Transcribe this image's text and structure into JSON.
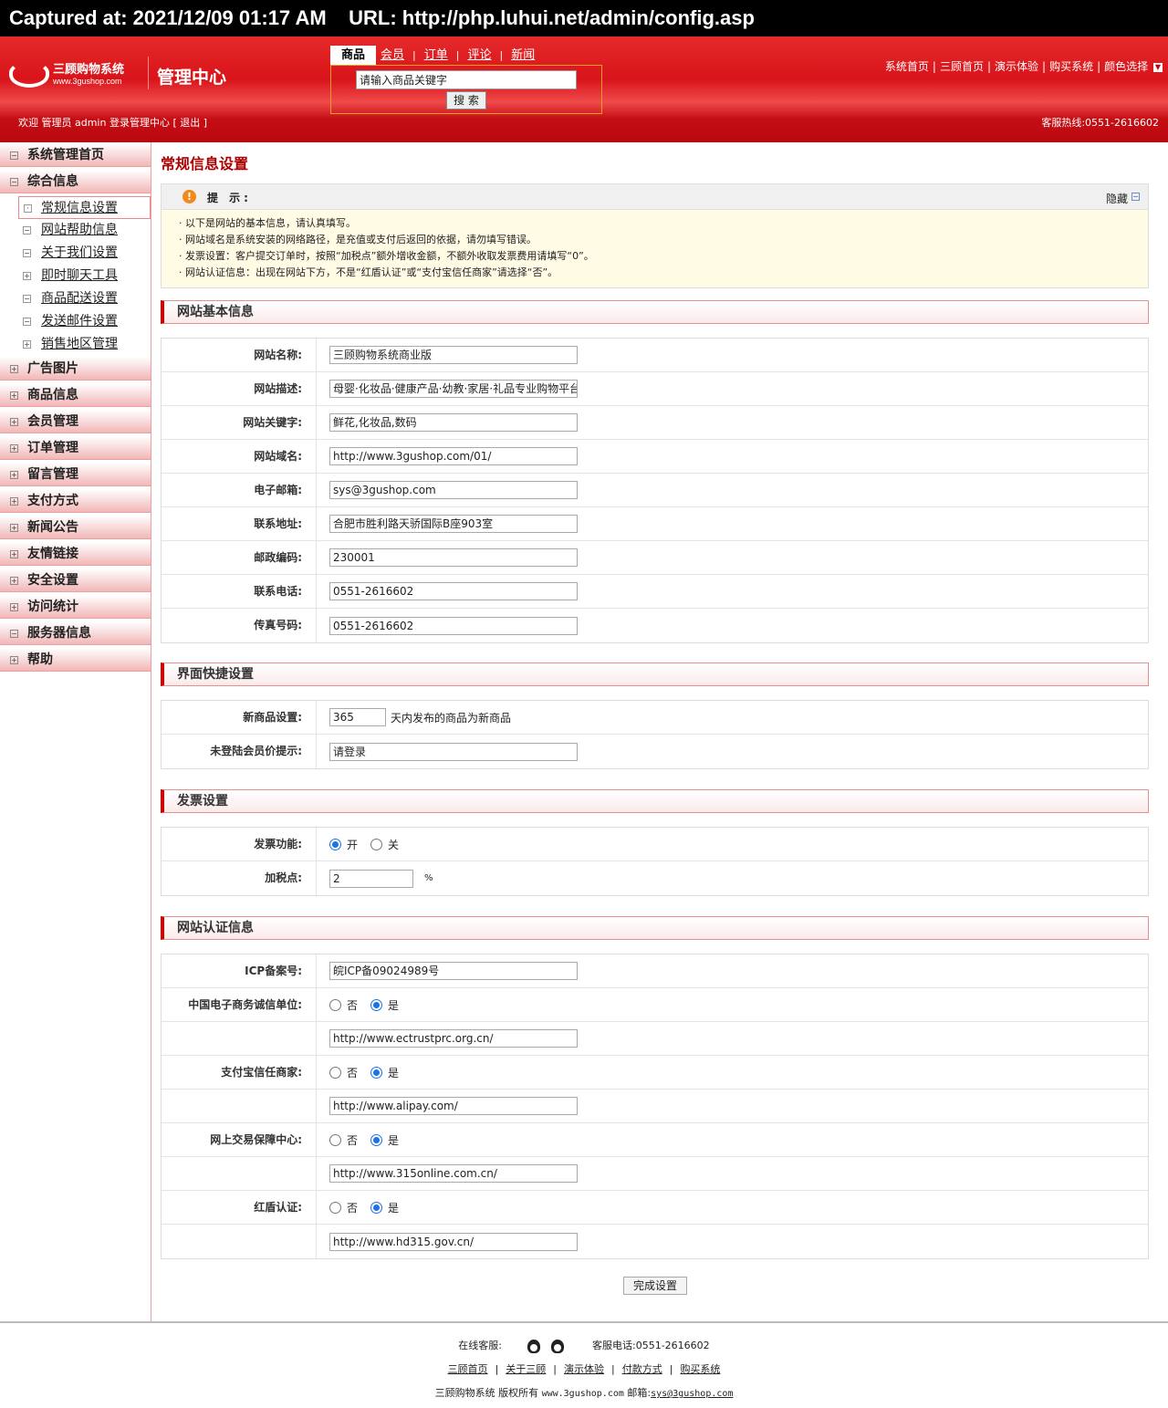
{
  "capture": {
    "text": "Captured at: 2021/12/09 01:17 AM    URL: http://php.luhui.net/admin/config.asp"
  },
  "header": {
    "logo_name": "三顾购物系统",
    "logo_url": "www.3gushop.com",
    "admin_title": "管理中心",
    "search_tabs": [
      "商品",
      "会员",
      "订单",
      "评论",
      "新闻"
    ],
    "search_placeholder": "请输入商品关键字",
    "search_button": "搜 索",
    "top_links": [
      "系统首页",
      "三顾首页",
      "演示体验",
      "购买系统",
      "颜色选择"
    ],
    "welcome": "欢迎 管理员 admin 登录管理中心 [ 退出 ]",
    "hotline": "客服热线:0551-2616602"
  },
  "sidebar": {
    "top": [
      {
        "icon": "minus",
        "label": "系统管理首页"
      },
      {
        "icon": "minus",
        "label": "综合信息"
      }
    ],
    "sub": [
      {
        "label": "常规信息设置",
        "active": true
      },
      {
        "label": "网站帮助信息"
      },
      {
        "label": "关于我们设置"
      },
      {
        "label": "即时聊天工具"
      },
      {
        "label": "商品配送设置"
      },
      {
        "label": "发送邮件设置"
      },
      {
        "label": "销售地区管理"
      }
    ],
    "rest": [
      "广告图片",
      "商品信息",
      "会员管理",
      "订单管理",
      "留言管理",
      "支付方式",
      "新闻公告",
      "友情链接",
      "安全设置",
      "访问统计",
      "服务器信息",
      "帮助"
    ]
  },
  "page": {
    "title": "常规信息设置",
    "tip_label": "提 示:",
    "tip_hide": "隐藏",
    "tips": [
      "· 以下是网站的基本信息，请认真填写。",
      "· 网站域名是系统安装的网络路径，是充值或支付后返回的依据，请勿填写错误。",
      "· 发票设置：客户提交订单时，按照“加税点”额外增收金额，不额外收取发票费用请填写“0”。",
      "· 网站认证信息：出现在网站下方，不是“红盾认证”或“支付宝信任商家”请选择“否”。"
    ],
    "sections": {
      "basic": "网站基本信息",
      "ui": "界面快捷设置",
      "invoice": "发票设置",
      "cert": "网站认证信息"
    },
    "basic_fields": [
      {
        "label": "网站名称:",
        "value": "三顾购物系统商业版"
      },
      {
        "label": "网站描述:",
        "value": "母婴·化妆品·健康产品·幼教·家居·礼品专业购物平台"
      },
      {
        "label": "网站关键字:",
        "value": "鲜花,化妆品,数码"
      },
      {
        "label": "网站域名:",
        "value": "http://www.3gushop.com/01/"
      },
      {
        "label": "电子邮箱:",
        "value": "sys@3gushop.com"
      },
      {
        "label": "联系地址:",
        "value": "合肥市胜利路天骄国际B座903室"
      },
      {
        "label": "邮政编码:",
        "value": "230001"
      },
      {
        "label": "联系电话:",
        "value": "0551-2616602"
      },
      {
        "label": "传真号码:",
        "value": "0551-2616602"
      }
    ],
    "ui_fields": {
      "new_label": "新商品设置:",
      "new_value": "365",
      "new_suffix": "天内发布的商品为新商品",
      "guest_label": "未登陆会员价提示:",
      "guest_value": "请登录"
    },
    "invoice_fields": {
      "func_label": "发票功能:",
      "on": "开",
      "off": "关",
      "tax_label": "加税点:",
      "tax_value": "2",
      "tax_unit": "%"
    },
    "cert_fields": {
      "icp_label": "ICP备案号:",
      "icp_value": "皖ICP备09024989号",
      "no": "否",
      "yes": "是",
      "items": [
        {
          "label": "中国电子商务诚信单位:",
          "url": "http://www.ectrustprc.org.cn/"
        },
        {
          "label": "支付宝信任商家:",
          "url": "http://www.alipay.com/"
        },
        {
          "label": "网上交易保障中心:",
          "url": "http://www.315online.com.cn/"
        },
        {
          "label": "红盾认证:",
          "url": "http://www.hd315.gov.cn/"
        }
      ]
    },
    "submit": "完成设置"
  },
  "footer": {
    "online": "在线客服:",
    "phone": "客服电话:0551-2616602",
    "links": [
      "三顾首页",
      "关于三顾",
      "演示体验",
      "付款方式",
      "购买系统"
    ],
    "copyright": "三顾购物系统 版权所有",
    "site": "www.3gushop.com",
    "email_label": "邮箱:",
    "email": "sys@3gushop.com"
  }
}
